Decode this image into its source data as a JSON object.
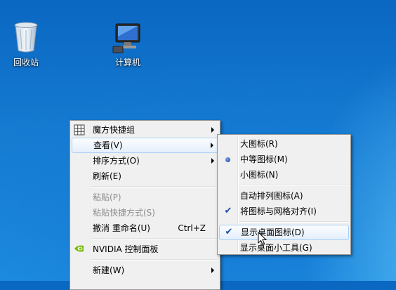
{
  "desktop": {
    "icons": [
      {
        "label": "回收站",
        "icon": "recycle-bin-icon"
      },
      {
        "label": "计算机",
        "icon": "computer-icon"
      }
    ]
  },
  "context_menu": {
    "items": [
      {
        "label": "魔方快捷组",
        "icon": "grid-icon",
        "submenu": true
      },
      {
        "label": "查看(V)",
        "submenu": true,
        "highlighted": true
      },
      {
        "label": "排序方式(O)",
        "submenu": true
      },
      {
        "label": "刷新(E)"
      },
      {
        "label": "粘贴(P)",
        "disabled": true
      },
      {
        "label": "粘贴快捷方式(S)",
        "disabled": true
      },
      {
        "label": "撤消 重命名(U)",
        "shortcut": "Ctrl+Z"
      },
      {
        "label": "NVIDIA 控制面板",
        "icon": "nvidia-icon"
      },
      {
        "label": "新建(W)",
        "submenu": true
      }
    ]
  },
  "view_submenu": {
    "items": [
      {
        "label": "大图标(R)"
      },
      {
        "label": "中等图标(M)",
        "bullet": true
      },
      {
        "label": "小图标(N)"
      },
      {
        "label": "自动排列图标(A)"
      },
      {
        "label": "将图标与网格对齐(I)",
        "checked": true
      },
      {
        "label": "显示桌面图标(D)",
        "checked": true,
        "highlighted": true
      },
      {
        "label": "显示桌面小工具(G)"
      }
    ]
  },
  "colors": {
    "accent": "#a8d0f5",
    "desktop": "#157ad1"
  }
}
